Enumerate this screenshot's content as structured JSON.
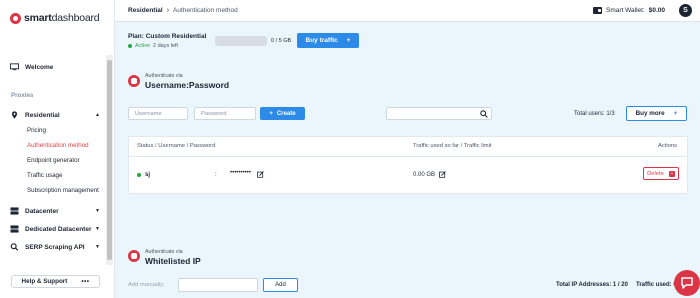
{
  "brand": {
    "name_bold": "smart",
    "name_rest": "dashboard"
  },
  "sidebar": {
    "welcome": "Welcome",
    "section_proxies": "Proxies",
    "residential": "Residential",
    "sub_items": [
      "Pricing",
      "Authentication method",
      "Endpoint generator",
      "Traffic usage",
      "Subscription management"
    ],
    "datacenter": "Datacenter",
    "dedicated_datacenter": "Dedicated Datacenter",
    "serp": "SERP Scraping API",
    "help": "Help & Support",
    "help_dots": "•••"
  },
  "topbar": {
    "crumb_first": "Residential",
    "crumb_sep": "›",
    "crumb_last": "Authentication method",
    "wallet_label": "Smart Wallet:",
    "wallet_value": "$0.00",
    "avatar_initial": "S"
  },
  "plan": {
    "title": "Plan: Custom Residential",
    "status": "Active",
    "days_left": "2 days left",
    "usage_text": "0 / 5 GB",
    "usage_fraction": 0.0,
    "buy_traffic": "Buy traffic",
    "plus": "+"
  },
  "userpass": {
    "via": "Authenticate via",
    "method": "Username:Password",
    "username_placeholder": "Username",
    "password_placeholder": "Password",
    "create_label": "Create",
    "create_plus": "+",
    "total_users": "Total users: 1/3",
    "buy_more": "Buy more",
    "buy_more_plus": "+"
  },
  "table": {
    "headers": [
      "Status / Username / Password",
      "Traffic used so far / Traffic limit",
      "Actions"
    ],
    "rows": [
      {
        "username": "sj",
        "colon": ":",
        "password": "••••••••••",
        "traffic": "0.00 GB",
        "delete_label": "Delete",
        "delete_x": "×"
      }
    ]
  },
  "whitelist": {
    "via": "Authenticate via",
    "method": "Whitelisted IP",
    "add_manually": "Add manually:",
    "add_label": "Add",
    "total_ip": "Total IP Addresses: 1 / 20",
    "traffic_used": "Traffic used: 0"
  },
  "colors": {
    "accent": "#2d8ae6",
    "brand": "#dc3545",
    "active": "#28a745"
  }
}
